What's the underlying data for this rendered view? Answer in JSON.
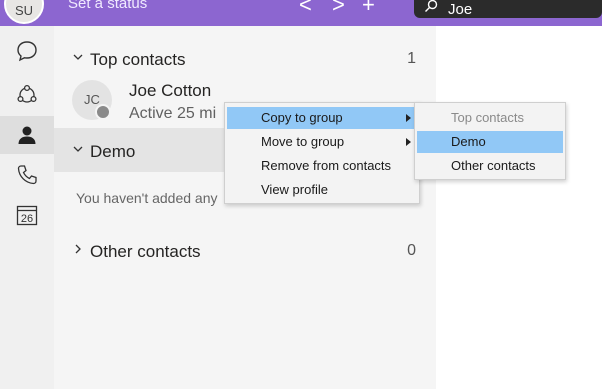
{
  "topbar": {
    "avatar_initials": "SU",
    "status_placeholder": "Set a status",
    "back_symbol": "<",
    "forward_symbol": ">",
    "new_symbol": "+",
    "search_value": "Joe",
    "color": "#8c66d0"
  },
  "rail": {
    "items": [
      {
        "icon": "chat-icon"
      },
      {
        "icon": "network-icon"
      },
      {
        "icon": "contacts-icon",
        "active": true
      },
      {
        "icon": "phone-icon"
      },
      {
        "icon": "calendar-icon",
        "date": "26"
      }
    ]
  },
  "contacts": {
    "groups": [
      {
        "name": "Top contacts",
        "count": "1",
        "expanded": true
      },
      {
        "name": "Demo",
        "expanded": true,
        "selected": true
      },
      {
        "name": "Other contacts",
        "count": "0",
        "expanded": false
      }
    ],
    "top_contact": {
      "initials": "JC",
      "name": "Joe Cotton",
      "status": "Active 25 mi"
    },
    "demo_empty_text": "You haven't added any"
  },
  "context_menu": {
    "items": [
      {
        "label": "Copy to group",
        "submenu": true,
        "highlighted": true
      },
      {
        "label": "Move to group",
        "submenu": true
      },
      {
        "label": "Remove from contacts"
      },
      {
        "label": "View profile"
      }
    ]
  },
  "submenu": {
    "items": [
      {
        "label": "Top contacts",
        "disabled": true
      },
      {
        "label": "Demo",
        "highlighted": true
      },
      {
        "label": "Other contacts"
      }
    ]
  },
  "colors": {
    "highlight": "#91c8f6",
    "accent": "#8c66d0"
  }
}
